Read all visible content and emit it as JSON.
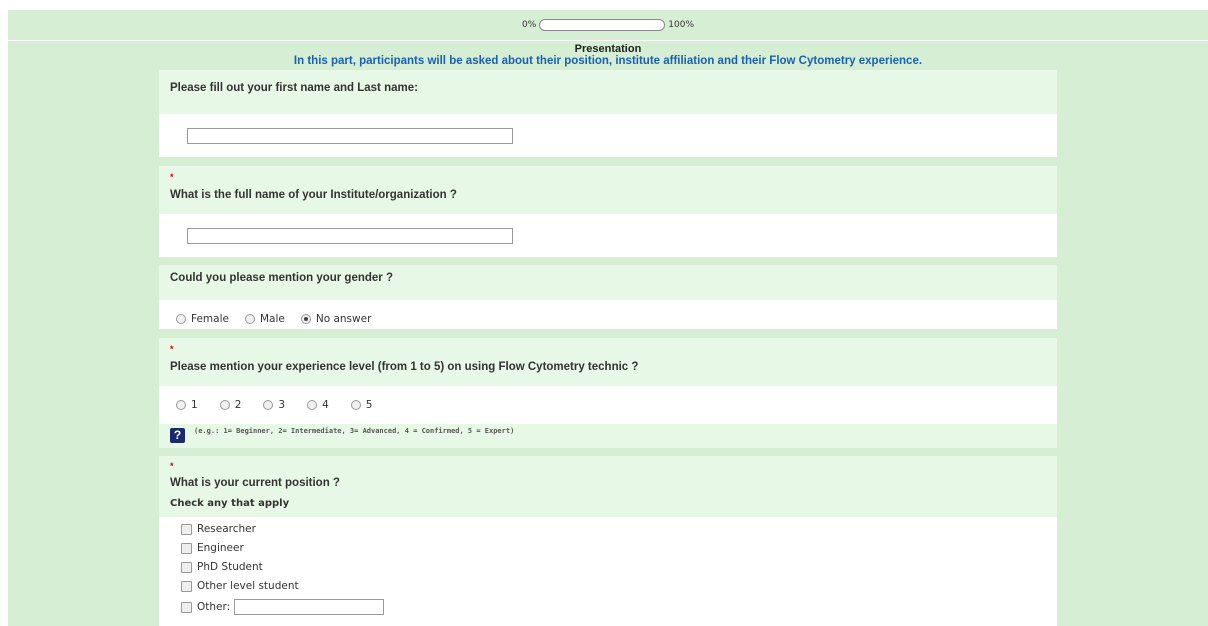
{
  "progress": {
    "start_label": "0%",
    "end_label": "100%",
    "value": 0
  },
  "group": {
    "title": "Presentation",
    "description": "In this part, participants will be asked about their position, institute affiliation and their Flow Cytometry experience."
  },
  "q1": {
    "text": "Please fill out your first name and Last name:",
    "value": ""
  },
  "q2": {
    "mandatory": "*",
    "text": "What is the full name of your Institute/organization ?",
    "value": ""
  },
  "q3": {
    "text": "Could you please mention your gender ?",
    "options": [
      "Female",
      "Male",
      "No answer"
    ],
    "selected": "No answer"
  },
  "q4": {
    "mandatory": "*",
    "text": "Please mention your experience level (from 1 to 5) on using Flow Cytometry technic ?",
    "options": [
      "1",
      "2",
      "3",
      "4",
      "5"
    ],
    "help_icon": "?",
    "help": "(e.g.: 1= Beginner, 2= Intermediate, 3= Advanced, 4 = Confirmed, 5 = Expert)"
  },
  "q5": {
    "mandatory": "*",
    "text": "What is your current position ?",
    "subtitle": "Check any that apply",
    "options": [
      "Researcher",
      "Engineer",
      "PhD Student",
      "Other level student",
      "Other:"
    ]
  },
  "colors": {
    "background": "#d6efd4",
    "question_header": "#e8f8e6",
    "description": "#1a5fb4",
    "mandatory": "#d00"
  }
}
